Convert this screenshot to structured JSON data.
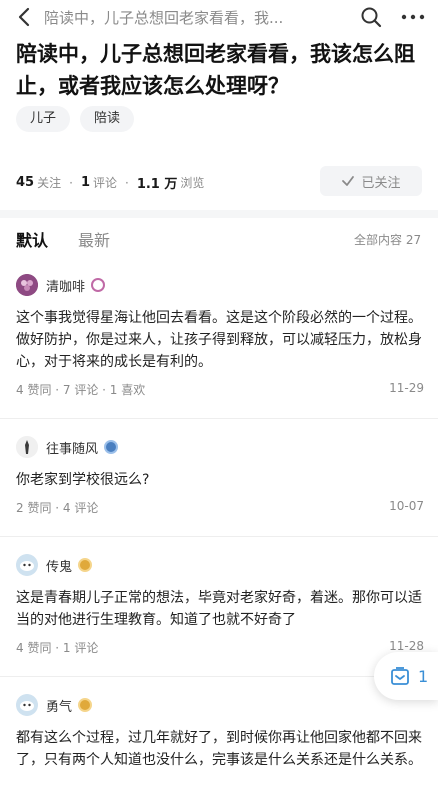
{
  "nav": {
    "title": "陪读中，儿子总想回老家看看，我...",
    "icons": [
      "back-icon",
      "search-icon",
      "more-icon"
    ]
  },
  "question": {
    "title": "陪读中，儿子总想回老家看看，我该怎么阻止，或者我应该怎么处理呀？",
    "tags": [
      "儿子",
      "陪读"
    ],
    "stats": {
      "follow_count": "45",
      "follow_label": "关注",
      "comment_count": "1",
      "comment_label": "评论",
      "view_count": "1.1 万",
      "view_label": "浏览"
    },
    "followed_label": "已关注"
  },
  "sort": {
    "tabs": [
      "默认",
      "最新"
    ],
    "active": "默认",
    "all_count": "全部内容 27"
  },
  "comments": [
    {
      "name": "清咖啡",
      "text": "这个事我觉得星海让他回去看看。这是这个阶段必然的一个过程。做好防护，你是过来人，让孩子得到释放，可以减轻压力，放松身心，对于将来的成长是有利的。",
      "meta": "4 赞同 · 7 评论 · 1 喜欢",
      "date": "11-29"
    },
    {
      "name": "往事随风",
      "text": "你老家到学校很远么?",
      "meta": "2 赞同 · 4 评论",
      "date": "10-07"
    },
    {
      "name": "传鬼",
      "text": "这是青春期儿子正常的想法，毕竟对老家好奇，着迷。那你可以适当的对他进行生理教育。知道了也就不好奇了",
      "meta": "4 赞同 · 1 评论",
      "date": "11-28"
    },
    {
      "name": "勇气",
      "text": "都有这么个过程，过几年就好了，到时候你再让他回家他都不回来了，只有两个人知道也没什么，完事该是什么关系还是什么关系。",
      "meta": "",
      "date": ""
    }
  ],
  "float_button": {
    "count": "1"
  },
  "colors": {
    "accent": "#3a8fd6",
    "muted": "#8a8a8a",
    "tag_bg": "#f3f4f6"
  }
}
